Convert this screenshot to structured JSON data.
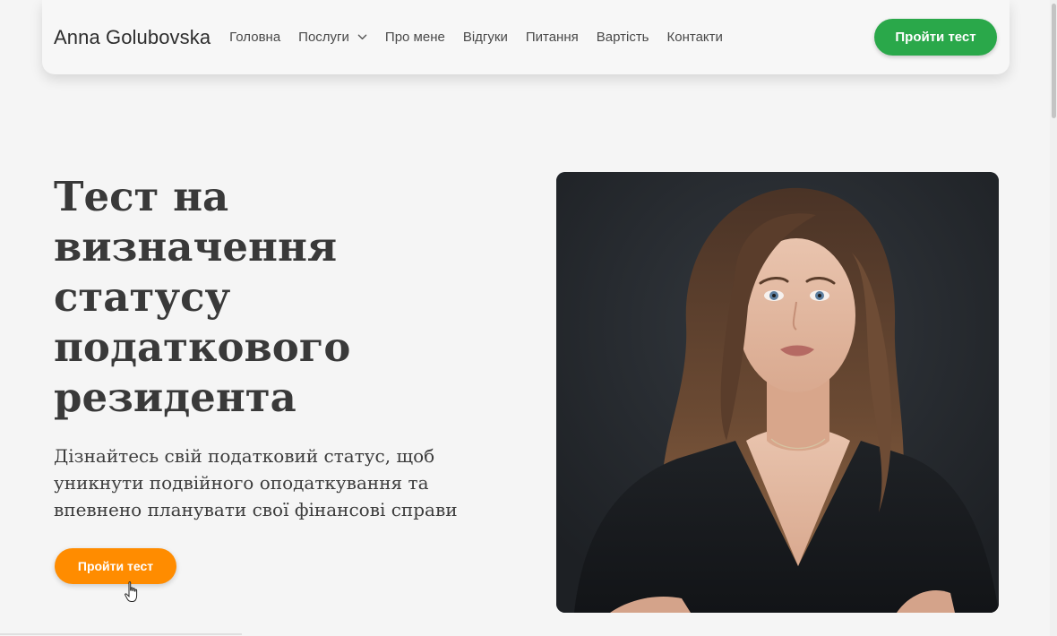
{
  "brand": {
    "name": "Anna Golubovska"
  },
  "nav": {
    "items": [
      {
        "label": "Головна"
      },
      {
        "label": "Послуги",
        "has_dropdown": true
      },
      {
        "label": "Про мене"
      },
      {
        "label": "Відгуки"
      },
      {
        "label": "Питання"
      },
      {
        "label": "Вартість"
      },
      {
        "label": "Контакти"
      }
    ],
    "cta_label": "Пройти тест"
  },
  "hero": {
    "title": "Тест на визначення статусу податкового резидента",
    "subtitle": "Дізнайтесь свій податковий статус, щоб уникнути подвійного оподаткування та впевнено планувати свої фінансові справи",
    "cta_label": "Пройти тест"
  },
  "icons": {
    "dropdown": "chevron-down-icon",
    "pointer": "hand-cursor-icon"
  },
  "colors": {
    "header_cta": "#2aa84a",
    "hero_cta": "#ff8c00",
    "background": "#f5f5f5",
    "photo_bg": "#23272c"
  }
}
